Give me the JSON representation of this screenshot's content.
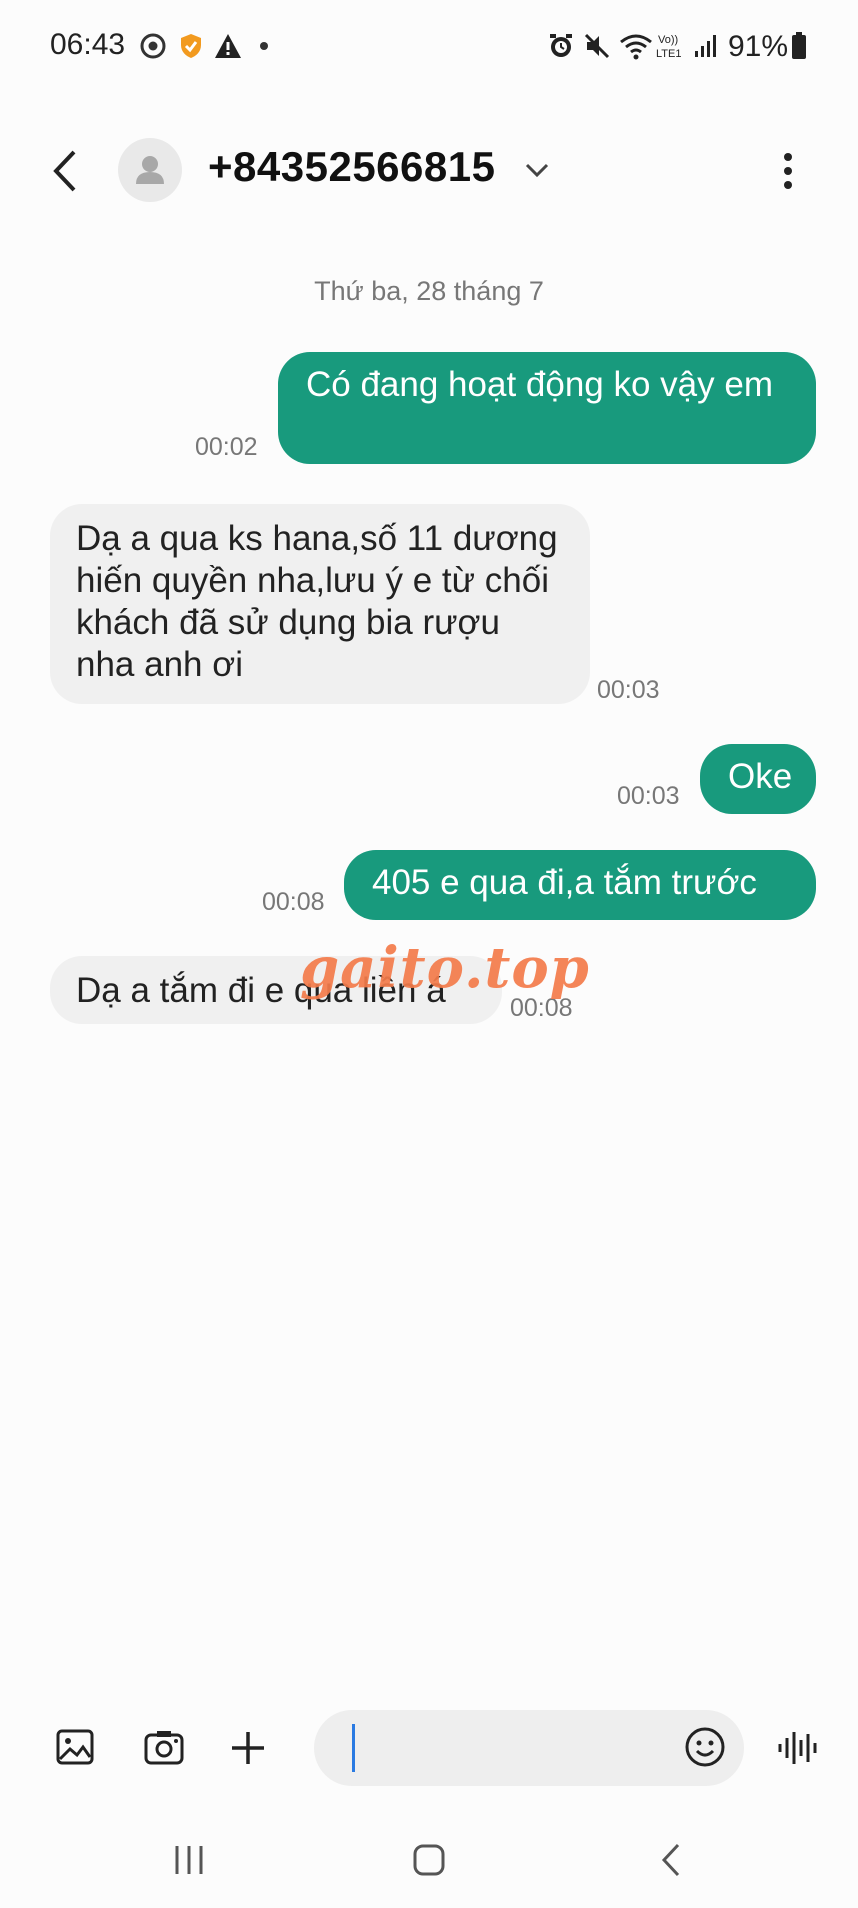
{
  "status_bar": {
    "time": "06:43",
    "battery": "91%",
    "icons_left": [
      "chrome-icon",
      "shield-icon",
      "warning-icon",
      "dot-icon"
    ],
    "icons_right": [
      "alarm-icon",
      "mute-icon",
      "wifi-icon",
      "volte-icon",
      "signal-icon",
      "battery-icon"
    ]
  },
  "header": {
    "contact": "+84352566815"
  },
  "conversation": {
    "date_separator": "Thứ ba, 28 tháng 7",
    "messages": [
      {
        "direction": "out",
        "text": "Có đang hoạt động ko vậy em",
        "time": "00:02"
      },
      {
        "direction": "in",
        "text": "Dạ a qua ks hana,số 11 dương hiến quyền nha,lưu ý e từ chối khách đã sử dụng bia rượu nha anh ơi",
        "time": "00:03"
      },
      {
        "direction": "out",
        "text": "Oke",
        "time": "00:03"
      },
      {
        "direction": "out",
        "text": "405 e qua đi,a tắm trước",
        "time": "00:08"
      },
      {
        "direction": "in",
        "text": "Dạ a tắm đi e qua liền á",
        "time": "00:08"
      }
    ]
  },
  "watermark": "gaito.top",
  "composer": {
    "placeholder": ""
  },
  "colors": {
    "outgoing_bubble": "#189a7d",
    "incoming_bubble": "#f0f0f0",
    "watermark": "#f47b4b"
  }
}
